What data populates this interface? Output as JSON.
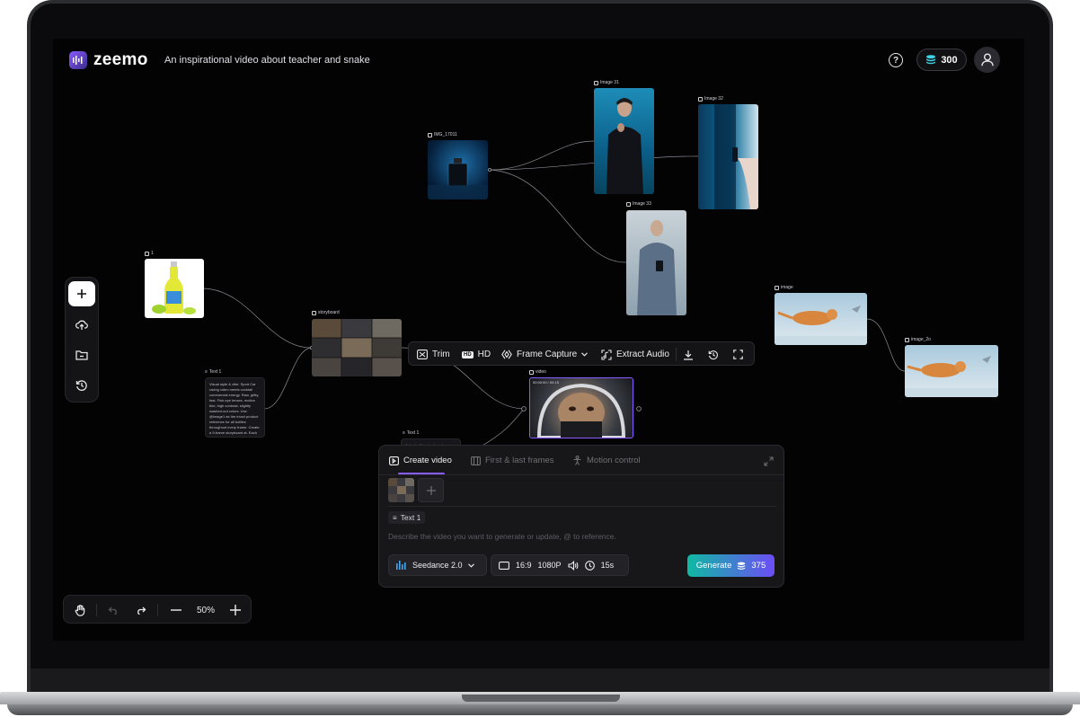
{
  "app": {
    "name": "zeemo",
    "project_title": "An inspirational video about teacher and snake",
    "credits": "300",
    "help_symbol": "?"
  },
  "canvas": {
    "nodes": {
      "bottle": {
        "label": "1"
      },
      "perfume": {
        "label": "IMG_17011"
      },
      "image31": {
        "label": "Image 31"
      },
      "image32": {
        "label": "Image 32"
      },
      "image33": {
        "label": "Image 33"
      },
      "storyboard": {
        "label": "storyboard"
      },
      "text1": {
        "label": "Text 1",
        "body": "Visual style & vibe: Sport Car racing video meets cocktail commercial energy. Raw, gritty, fast. Fish-eye lenses, motion blur, high contrast, slightly washed-out colors. Use @image1 as the exact product reference for all bottles throughout every frame. Create a 9-frame storyboard at. Each frame varies in shot type and"
      },
      "text1_lower": {
        "label": "Text 1",
        "body": "Animate this storyboard"
      },
      "video": {
        "label": "video",
        "overlay": "00:00:00 / 00:15"
      },
      "cat_image": {
        "label": "image"
      },
      "cat_image_2": {
        "label": "image_2o"
      }
    },
    "zoom": "50%"
  },
  "toolbar": {
    "trim": "Trim",
    "hd": "HD",
    "frame_capture": "Frame Capture",
    "extract_audio": "Extract Audio"
  },
  "panel": {
    "tabs": [
      {
        "label": "Create video",
        "active": true
      },
      {
        "label": "First & last frames",
        "active": false
      },
      {
        "label": "Motion control",
        "active": false
      }
    ],
    "reference_chip": "Text 1",
    "prompt_placeholder": "Describe the video you want to generate or update, @ to reference.",
    "model": "Seedance 2.0",
    "aspect_ratio": "16:9",
    "resolution": "1080P",
    "duration": "15s",
    "generate_label": "Generate",
    "generate_cost": "375"
  },
  "colors": {
    "accent": "#8a5cff",
    "generate_gradient_start": "#0fb9a3",
    "generate_gradient_end": "#6c4df5",
    "background": "#030304"
  }
}
